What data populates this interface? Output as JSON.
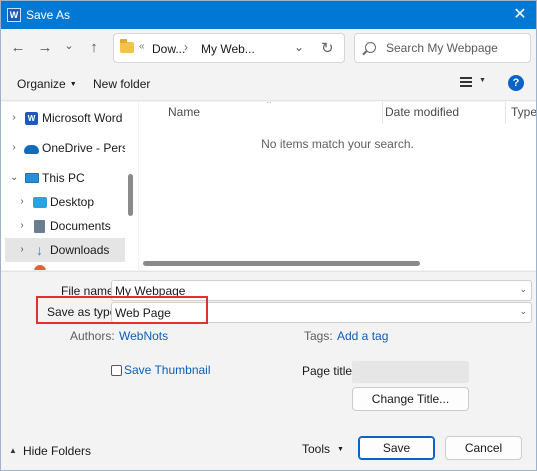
{
  "window": {
    "title": "Save As",
    "app_icon_letter": "W",
    "close_glyph": "✕"
  },
  "navbar": {
    "back_glyph": "←",
    "forward_glyph": "→",
    "recent_glyph": "⌄",
    "up_glyph": "↑",
    "address": {
      "overflow": "«",
      "segment_1": "Dow...",
      "separator": "›",
      "segment_2": "My Web...",
      "chevron": "⌄",
      "refresh_glyph": "↻"
    },
    "search": {
      "placeholder": "Search My Webpage"
    }
  },
  "toolbar": {
    "organize_label": "Organize",
    "new_folder_label": "New folder",
    "help_glyph": "?"
  },
  "nav_pane": {
    "items": [
      {
        "label": "Microsoft Word",
        "icon": "word-icon",
        "arrow": "›"
      },
      {
        "label": "OneDrive - Personal",
        "icon": "cloud-icon",
        "arrow": "›"
      },
      {
        "label": "This PC",
        "icon": "computer-icon",
        "arrow": "⌄"
      },
      {
        "label": "Desktop",
        "icon": "desktop-icon",
        "arrow": "›"
      },
      {
        "label": "Documents",
        "icon": "documents-icon",
        "arrow": "›"
      },
      {
        "label": "Downloads",
        "icon": "downloads-icon",
        "arrow": "›"
      }
    ]
  },
  "file_list": {
    "columns": [
      "Name",
      "Date modified",
      "Type"
    ],
    "sort_glyph": "^",
    "empty_message": "No items match your search."
  },
  "form": {
    "file_name_label": "File name:",
    "file_name_value": "My Webpage",
    "save_type_label": "Save as type:",
    "save_type_value": "Web Page",
    "authors_label": "Authors:",
    "authors_value": "WebNots",
    "tags_label": "Tags:",
    "tags_value": "Add a tag",
    "save_thumbnail_label": "Save Thumbnail",
    "page_title_label": "Page title:",
    "change_title_label": "Change Title..."
  },
  "footer": {
    "hide_folders_label": "Hide Folders",
    "tools_label": "Tools",
    "save_label": "Save",
    "cancel_label": "Cancel"
  },
  "colors": {
    "titlebar": "#0078d4",
    "link": "#0a5fb8",
    "highlight": "#e03030",
    "selection": "#e5e5e5"
  }
}
